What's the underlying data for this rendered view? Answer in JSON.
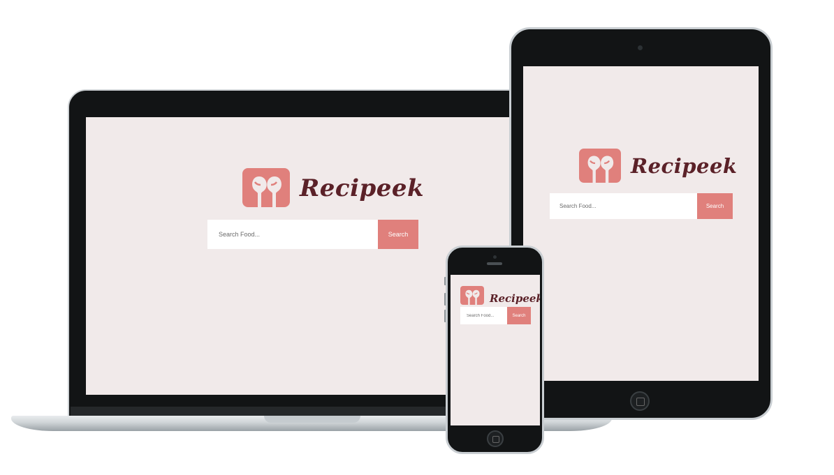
{
  "brand": {
    "name": "Recipeek",
    "logo_icon": "spoons-icon",
    "accent_color": "#e0807c",
    "text_color": "#5b2128",
    "background_color": "#f1eaea"
  },
  "search": {
    "placeholder": "Search Food...",
    "button_label": "Search"
  },
  "devices": [
    "laptop",
    "tablet",
    "phone"
  ]
}
